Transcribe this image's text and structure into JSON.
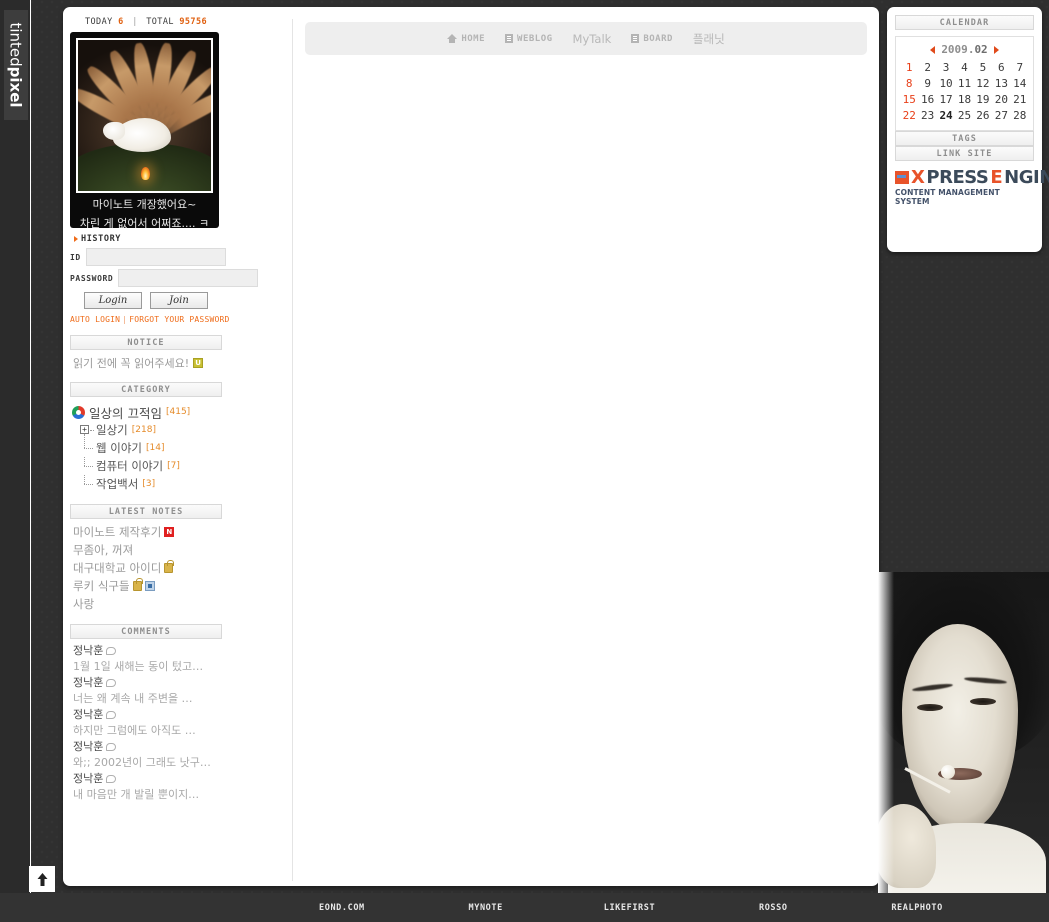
{
  "brand": {
    "name_light": "tinted",
    "name_bold": "pixel"
  },
  "counter": {
    "today_label": "TODAY",
    "today_value": "6",
    "separator": "|",
    "total_label": "TOTAL",
    "total_value": "95756"
  },
  "banner": {
    "caption_line1": "마이노트 개장했어요~",
    "caption_line2": "차린 게 없어서 어쩌죠.... ㅋ"
  },
  "history": {
    "label": "HISTORY"
  },
  "login": {
    "id_label": "ID",
    "id_value": "",
    "password_label": "PASSWORD",
    "password_value": "",
    "login_button": "Login",
    "join_button": "Join",
    "auto_login": "AUTO LOGIN",
    "divider": "|",
    "forgot_password": "FORGOT YOUR PASSWORD"
  },
  "notice": {
    "header": "NOTICE",
    "items": [
      {
        "text": "읽기 전에 꼭 읽어주세요!",
        "badge": "U"
      }
    ]
  },
  "category": {
    "header": "CATEGORY",
    "root": {
      "label": "일상의 끄적임",
      "count": "[415]"
    },
    "items": [
      {
        "label": "일상기",
        "count": "[218]",
        "expandable": true
      },
      {
        "label": "웹 이야기",
        "count": "[14]",
        "expandable": false
      },
      {
        "label": "컴퓨터 이야기",
        "count": "[7]",
        "expandable": false
      },
      {
        "label": "작업백서",
        "count": "[3]",
        "expandable": false
      }
    ]
  },
  "latest_notes": {
    "header": "LATEST NOTES",
    "items": [
      {
        "title": "마이노트 제작후기",
        "badges": [
          "new"
        ]
      },
      {
        "title": "무좀아, 꺼져",
        "badges": []
      },
      {
        "title": "대구대학교 아이디",
        "badges": [
          "lock"
        ]
      },
      {
        "title": "루키 식구들",
        "badges": [
          "lock",
          "image"
        ]
      },
      {
        "title": "사랑",
        "badges": []
      }
    ]
  },
  "comments": {
    "header": "COMMENTS",
    "items": [
      {
        "author": "정낙훈",
        "text": "1월 1일 새해는 동이 텄고…"
      },
      {
        "author": "정낙훈",
        "text": "너는 왜 계속 내 주변을 …"
      },
      {
        "author": "정낙훈",
        "text": "하지만 그럼에도 아직도 …"
      },
      {
        "author": "정낙훈",
        "text": "와;; 2002년이 그래도 낫구…"
      },
      {
        "author": "정낙훈",
        "text": "내 마음만 개 발릴 뿐이지…"
      }
    ]
  },
  "nav": {
    "items": [
      {
        "label": "HOME",
        "icon": "home-icon"
      },
      {
        "label": "WEBLOG",
        "icon": "document-icon"
      },
      {
        "label": "MyTalk",
        "icon": "none"
      },
      {
        "label": "BOARD",
        "icon": "document-icon"
      },
      {
        "label": "플래닛",
        "icon": "none"
      }
    ]
  },
  "calendar": {
    "header": "CALENDAR",
    "year": "2009",
    "dot": ".",
    "month": "02",
    "prev_arrow": "prev-month-arrow",
    "next_arrow": "next-month-arrow",
    "today": "24",
    "weeks": [
      [
        "1",
        "2",
        "3",
        "4",
        "5",
        "6",
        "7"
      ],
      [
        "8",
        "9",
        "10",
        "11",
        "12",
        "13",
        "14"
      ],
      [
        "15",
        "16",
        "17",
        "18",
        "19",
        "20",
        "21"
      ],
      [
        "22",
        "23",
        "24",
        "25",
        "26",
        "27",
        "28"
      ]
    ]
  },
  "tags": {
    "header": "TAGS"
  },
  "link_site": {
    "header": "LINK SITE"
  },
  "xe_logo": {
    "x": "X",
    "press": "PRESS ",
    "e": "E",
    "ngine": "NGINE",
    "tagline": "CONTENT MANAGEMENT SYSTEM"
  },
  "bottom_nav": {
    "items": [
      "EOND.COM",
      "MYNOTE",
      "LIKEFIRST",
      "ROSSO",
      "REALPHOTO"
    ]
  },
  "colors": {
    "accent_orange": "#ef6c1a",
    "count_orange": "#e58b2a",
    "sunday_red": "#e8401a",
    "background_dark": "#2f2f2f",
    "panel_white": "#ffffff",
    "header_gray": "#8e8e8e"
  }
}
